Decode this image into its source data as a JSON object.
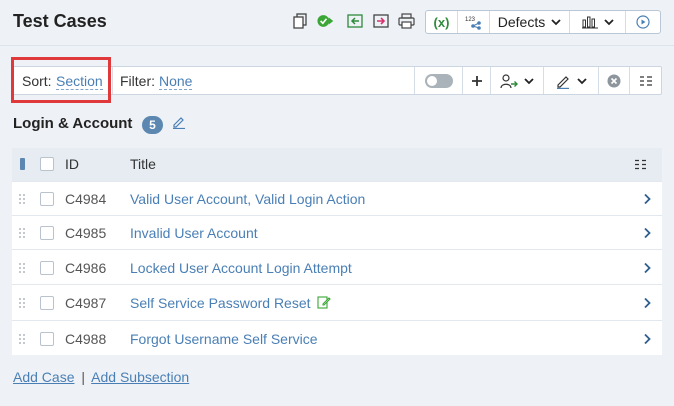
{
  "header": {
    "title": "Test Cases",
    "defects_label": "Defects",
    "icons": [
      "copy-icon",
      "run-icon",
      "import-icon",
      "export-icon",
      "print-icon",
      "variables-icon",
      "number-icon",
      "bar-chart-icon",
      "play-icon"
    ]
  },
  "filterbar": {
    "sort_label": "Sort:",
    "sort_value": "Section",
    "filter_label": "Filter:",
    "filter_value": "None"
  },
  "section": {
    "title": "Login & Account",
    "count": "5"
  },
  "table": {
    "columns": {
      "id": "ID",
      "title": "Title"
    },
    "rows": [
      {
        "id": "C4984",
        "title": "Valid User Account, Valid Login Action",
        "has_edit_icon": false
      },
      {
        "id": "C4985",
        "title": "Invalid User Account",
        "has_edit_icon": false
      },
      {
        "id": "C4986",
        "title": "Locked User Account Login Attempt",
        "has_edit_icon": false
      },
      {
        "id": "C4987",
        "title": "Self Service Password Reset",
        "has_edit_icon": true
      },
      {
        "id": "C4988",
        "title": "Forgot Username Self Service",
        "has_edit_icon": false
      }
    ]
  },
  "footer": {
    "add_case": "Add Case",
    "separator": "|",
    "add_subsection": "Add Subsection"
  },
  "colors": {
    "link": "#4a7fb5",
    "badge": "#5b87b0",
    "highlight": "#e0393b",
    "run_icon": "#3aa635",
    "export_icon": "#d6336c"
  }
}
